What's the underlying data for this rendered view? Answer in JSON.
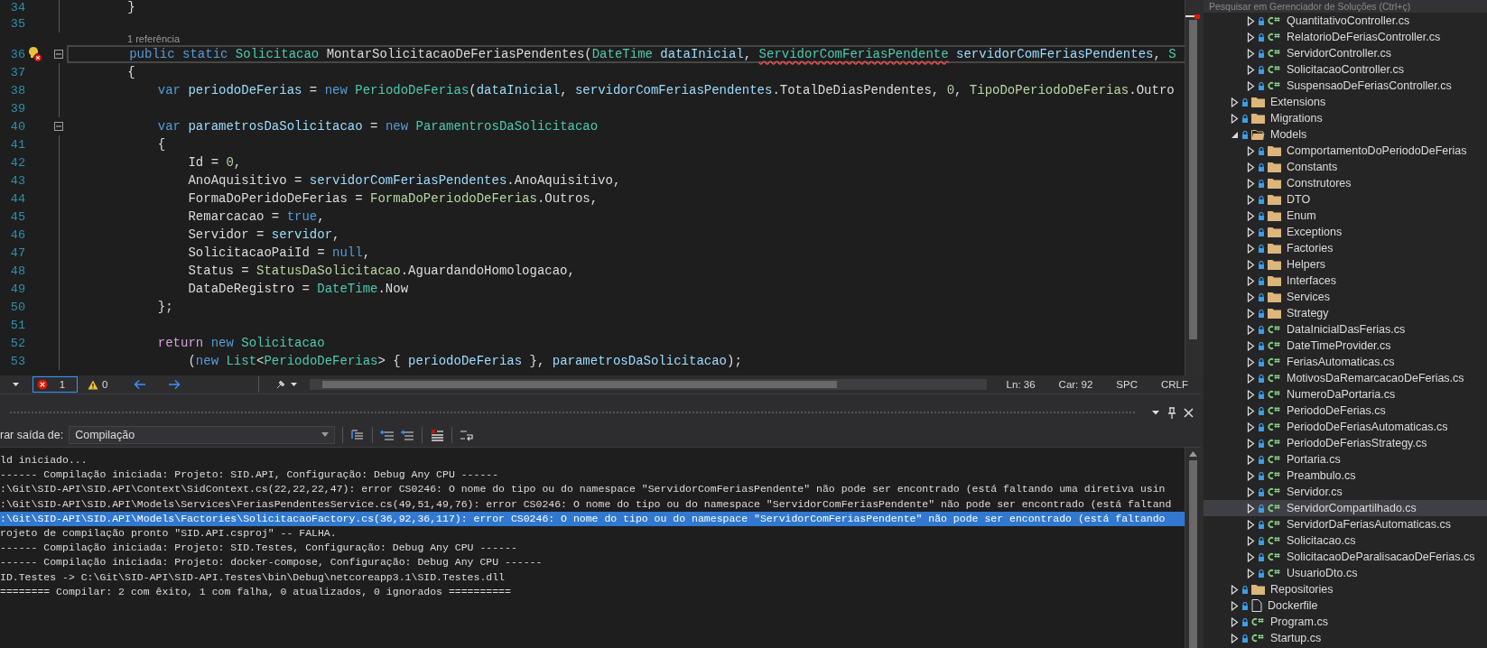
{
  "editor": {
    "lines": [
      {
        "number": "34",
        "tokens": [
          {
            "kind": "plain",
            "text": "        }"
          }
        ]
      },
      {
        "number": "35"
      },
      {
        "number": "36",
        "codelens": "1 referência",
        "current": true,
        "lightbulb": true,
        "expanded": true,
        "tokens": [
          {
            "kind": "keyword",
            "text": "        public"
          },
          {
            "kind": "keyword",
            "text": " static"
          },
          {
            "kind": "type",
            "text": " Solicitacao"
          },
          {
            "kind": "plain",
            "text": " MontarSolicitacaoDeFeriasPendentes("
          },
          {
            "kind": "type",
            "text": "DateTime"
          },
          {
            "kind": "variable",
            "text": " dataInicial"
          },
          {
            "kind": "plain",
            "text": ", "
          },
          {
            "kind": "type",
            "text": "ServidorComFeriasPendente",
            "error": true
          },
          {
            "kind": "variable",
            "text": " servidorComFeriasPendentes"
          },
          {
            "kind": "plain",
            "text": ", "
          },
          {
            "kind": "type",
            "text": "S"
          }
        ]
      },
      {
        "number": "37",
        "tokens": [
          {
            "kind": "plain",
            "text": "        {"
          }
        ]
      },
      {
        "number": "38",
        "tokens": [
          {
            "kind": "keyword",
            "text": "            var"
          },
          {
            "kind": "variable",
            "text": " periodoDeFerias"
          },
          {
            "kind": "plain",
            "text": " = "
          },
          {
            "kind": "keyword",
            "text": "new"
          },
          {
            "kind": "type",
            "text": " PeriodoDeFerias"
          },
          {
            "kind": "plain",
            "text": "("
          },
          {
            "kind": "variable",
            "text": "dataInicial"
          },
          {
            "kind": "plain",
            "text": ", "
          },
          {
            "kind": "variable",
            "text": "servidorComFeriasPendentes"
          },
          {
            "kind": "plain",
            "text": ".TotalDeDiasPendentes, "
          },
          {
            "kind": "number",
            "text": "0"
          },
          {
            "kind": "plain",
            "text": ", "
          },
          {
            "kind": "enum",
            "text": "TipoDoPeriodoDeFerias"
          },
          {
            "kind": "plain",
            "text": ".Outro"
          }
        ]
      },
      {
        "number": "39"
      },
      {
        "number": "40",
        "expanded": true,
        "tokens": [
          {
            "kind": "keyword",
            "text": "            var"
          },
          {
            "kind": "variable",
            "text": " parametrosDaSolicitacao"
          },
          {
            "kind": "plain",
            "text": " = "
          },
          {
            "kind": "keyword",
            "text": "new"
          },
          {
            "kind": "type",
            "text": " ParamentrosDaSolicitacao"
          }
        ]
      },
      {
        "number": "41",
        "tokens": [
          {
            "kind": "plain",
            "text": "            {"
          }
        ]
      },
      {
        "number": "42",
        "tokens": [
          {
            "kind": "plain",
            "text": "                Id = "
          },
          {
            "kind": "number",
            "text": "0"
          },
          {
            "kind": "plain",
            "text": ","
          }
        ]
      },
      {
        "number": "43",
        "tokens": [
          {
            "kind": "plain",
            "text": "                AnoAquisitivo = "
          },
          {
            "kind": "variable",
            "text": "servidorComFeriasPendentes"
          },
          {
            "kind": "plain",
            "text": ".AnoAquisitivo,"
          }
        ]
      },
      {
        "number": "44",
        "tokens": [
          {
            "kind": "plain",
            "text": "                FormaDoPeridoDeFerias = "
          },
          {
            "kind": "enum",
            "text": "FormaDoPeriodoDeFerias"
          },
          {
            "kind": "plain",
            "text": ".Outros,"
          }
        ]
      },
      {
        "number": "45",
        "tokens": [
          {
            "kind": "plain",
            "text": "                Remarcacao = "
          },
          {
            "kind": "keyword",
            "text": "true"
          },
          {
            "kind": "plain",
            "text": ","
          }
        ]
      },
      {
        "number": "46",
        "tokens": [
          {
            "kind": "plain",
            "text": "                Servidor = "
          },
          {
            "kind": "variable",
            "text": "servidor"
          },
          {
            "kind": "plain",
            "text": ","
          }
        ]
      },
      {
        "number": "47",
        "tokens": [
          {
            "kind": "plain",
            "text": "                SolicitacaoPaiId = "
          },
          {
            "kind": "keyword",
            "text": "null"
          },
          {
            "kind": "plain",
            "text": ","
          }
        ]
      },
      {
        "number": "48",
        "tokens": [
          {
            "kind": "plain",
            "text": "                Status = "
          },
          {
            "kind": "enum",
            "text": "StatusDaSolicitacao"
          },
          {
            "kind": "plain",
            "text": ".AguardandoHomologacao,"
          }
        ]
      },
      {
        "number": "49",
        "tokens": [
          {
            "kind": "plain",
            "text": "                DataDeRegistro = "
          },
          {
            "kind": "type",
            "text": "DateTime"
          },
          {
            "kind": "plain",
            "text": ".Now"
          }
        ]
      },
      {
        "number": "50",
        "tokens": [
          {
            "kind": "plain",
            "text": "            };"
          }
        ]
      },
      {
        "number": "51"
      },
      {
        "number": "52",
        "tokens": [
          {
            "kind": "control",
            "text": "            return"
          },
          {
            "kind": "keyword",
            "text": " new"
          },
          {
            "kind": "type",
            "text": " Solicitacao"
          }
        ]
      },
      {
        "number": "53",
        "tokens": [
          {
            "kind": "plain",
            "text": "                ("
          },
          {
            "kind": "keyword",
            "text": "new"
          },
          {
            "kind": "type",
            "text": " List"
          },
          {
            "kind": "plain",
            "text": "<"
          },
          {
            "kind": "type",
            "text": "PeriodoDeFerias"
          },
          {
            "kind": "plain",
            "text": "> { "
          },
          {
            "kind": "variable",
            "text": "periodoDeFerias"
          },
          {
            "kind": "plain",
            "text": " }, "
          },
          {
            "kind": "variable",
            "text": "parametrosDaSolicitacao"
          },
          {
            "kind": "plain",
            "text": ");"
          }
        ]
      }
    ]
  },
  "editor_status": {
    "errors": {
      "count": "1",
      "selected": true
    },
    "warnings": {
      "count": "0",
      "selected": false
    },
    "line": "Ln: 36",
    "column": "Car: 92",
    "spacing": "SPC",
    "line_ending": "CRLF"
  },
  "output": {
    "source_label": "rar saída de:",
    "source": "Compilação",
    "lines": [
      {
        "text": "ld iniciado...",
        "selected": false
      },
      {
        "text": "------ Compilação iniciada: Projeto: SID.API, Configuração: Debug Any CPU ------",
        "selected": false
      },
      {
        "text": ":\\Git\\SID-API\\SID.API\\Context\\SidContext.cs(22,22,22,47): error CS0246: O nome do tipo ou do namespace \"ServidorComFeriasPendente\" não pode ser encontrado (está faltando uma diretiva usin",
        "selected": false
      },
      {
        "text": ":\\Git\\SID-API\\SID.API\\Models\\Services\\FeriasPendentesService.cs(49,51,49,76): error CS0246: O nome do tipo ou do namespace \"ServidorComFeriasPendente\" não pode ser encontrado (está faltand",
        "selected": false
      },
      {
        "text": ":\\Git\\SID-API\\SID.API\\Models\\Factories\\SolicitacaoFactory.cs(36,92,36,117): error CS0246: O nome do tipo ou do namespace \"ServidorComFeriasPendente\" não pode ser encontrado (está faltando",
        "selected": true
      },
      {
        "text": "rojeto de compilação pronto \"SID.API.csproj\" -- FALHA.",
        "selected": false
      },
      {
        "text": "------ Compilação iniciada: Projeto: SID.Testes, Configuração: Debug Any CPU ------",
        "selected": false
      },
      {
        "text": "------ Compilação iniciada: Projeto: docker-compose, Configuração: Debug Any CPU ------",
        "selected": false
      },
      {
        "text": "ID.Testes -> C:\\Git\\SID-API\\SID-API.Testes\\bin\\Debug\\netcoreapp3.1\\SID.Testes.dll",
        "selected": false
      },
      {
        "text": "======== Compilar: 2 com êxito, 1 com falha, 0 atualizados, 0 ignorados ==========",
        "selected": false
      }
    ]
  },
  "solution_explorer": {
    "search": {
      "placeholder": "Pesquisar em Gerenciador de Soluções (Ctrl+ç)"
    },
    "partial_group": [
      {
        "label": "QuantitativoController.cs",
        "kind": "csharp",
        "expanded": false,
        "selected": false
      },
      {
        "label": "RelatorioDeFeriasController.cs",
        "kind": "csharp",
        "expanded": false,
        "selected": false
      },
      {
        "label": "ServidorController.cs",
        "kind": "csharp",
        "expanded": false,
        "selected": false
      },
      {
        "label": "SolicitacaoController.cs",
        "kind": "csharp",
        "expanded": false,
        "selected": false
      },
      {
        "label": "SuspensaoDeFeriasController.cs",
        "kind": "csharp",
        "expanded": false,
        "selected": false
      }
    ],
    "items": [
      {
        "label": "Extensions",
        "kind": "folder",
        "expanded": false,
        "selected": false
      },
      {
        "label": "Migrations",
        "kind": "folder",
        "expanded": false,
        "selected": false
      },
      {
        "label": "Models",
        "kind": "folder",
        "expanded": true,
        "selected": false,
        "children": [
          {
            "label": "ComportamentoDoPeriodoDeFerias",
            "kind": "folder",
            "expanded": false,
            "selected": false
          },
          {
            "label": "Constants",
            "kind": "folder",
            "expanded": false,
            "selected": false
          },
          {
            "label": "Construtores",
            "kind": "folder",
            "expanded": false,
            "selected": false
          },
          {
            "label": "DTO",
            "kind": "folder",
            "expanded": false,
            "selected": false
          },
          {
            "label": "Enum",
            "kind": "folder",
            "expanded": false,
            "selected": false
          },
          {
            "label": "Exceptions",
            "kind": "folder",
            "expanded": false,
            "selected": false
          },
          {
            "label": "Factories",
            "kind": "folder",
            "expanded": false,
            "selected": false
          },
          {
            "label": "Helpers",
            "kind": "folder",
            "expanded": false,
            "selected": false
          },
          {
            "label": "Interfaces",
            "kind": "folder",
            "expanded": false,
            "selected": false
          },
          {
            "label": "Services",
            "kind": "folder",
            "expanded": false,
            "selected": false
          },
          {
            "label": "Strategy",
            "kind": "folder",
            "expanded": false,
            "selected": false
          },
          {
            "label": "DataInicialDasFerias.cs",
            "kind": "csharp",
            "expanded": false,
            "selected": false
          },
          {
            "label": "DateTimeProvider.cs",
            "kind": "csharp",
            "expanded": false,
            "selected": false
          },
          {
            "label": "FeriasAutomaticas.cs",
            "kind": "csharp",
            "expanded": false,
            "selected": false
          },
          {
            "label": "MotivosDaRemarcacaoDeFerias.cs",
            "kind": "csharp",
            "expanded": false,
            "selected": false
          },
          {
            "label": "NumeroDaPortaria.cs",
            "kind": "csharp",
            "expanded": false,
            "selected": false
          },
          {
            "label": "PeriodoDeFerias.cs",
            "kind": "csharp",
            "expanded": false,
            "selected": false
          },
          {
            "label": "PeriodoDeFeriasAutomaticas.cs",
            "kind": "csharp",
            "expanded": false,
            "selected": false
          },
          {
            "label": "PeriodoDeFeriasStrategy.cs",
            "kind": "csharp",
            "expanded": false,
            "selected": false
          },
          {
            "label": "Portaria.cs",
            "kind": "csharp",
            "expanded": false,
            "selected": false
          },
          {
            "label": "Preambulo.cs",
            "kind": "csharp",
            "expanded": false,
            "selected": false
          },
          {
            "label": "Servidor.cs",
            "kind": "csharp",
            "expanded": false,
            "selected": false
          },
          {
            "label": "ServidorCompartilhado.cs",
            "kind": "csharp",
            "expanded": false,
            "selected": true
          },
          {
            "label": "ServidorDaFeriasAutomaticas.cs",
            "kind": "csharp",
            "expanded": false,
            "selected": false
          },
          {
            "label": "Solicitacao.cs",
            "kind": "csharp",
            "expanded": false,
            "selected": false
          },
          {
            "label": "SolicitacaoDeParalisacaoDeFerias.cs",
            "kind": "csharp",
            "expanded": false,
            "selected": false
          },
          {
            "label": "UsuarioDto.cs",
            "kind": "csharp",
            "expanded": false,
            "selected": false
          }
        ]
      },
      {
        "label": "Repositories",
        "kind": "folder",
        "expanded": false,
        "selected": false
      },
      {
        "label": "Dockerfile",
        "kind": "file",
        "expanded": false,
        "selected": false
      },
      {
        "label": "Program.cs",
        "kind": "csharp",
        "expanded": false,
        "selected": false
      },
      {
        "label": "Startup.cs",
        "kind": "csharp",
        "expanded": false,
        "selected": false
      }
    ]
  }
}
